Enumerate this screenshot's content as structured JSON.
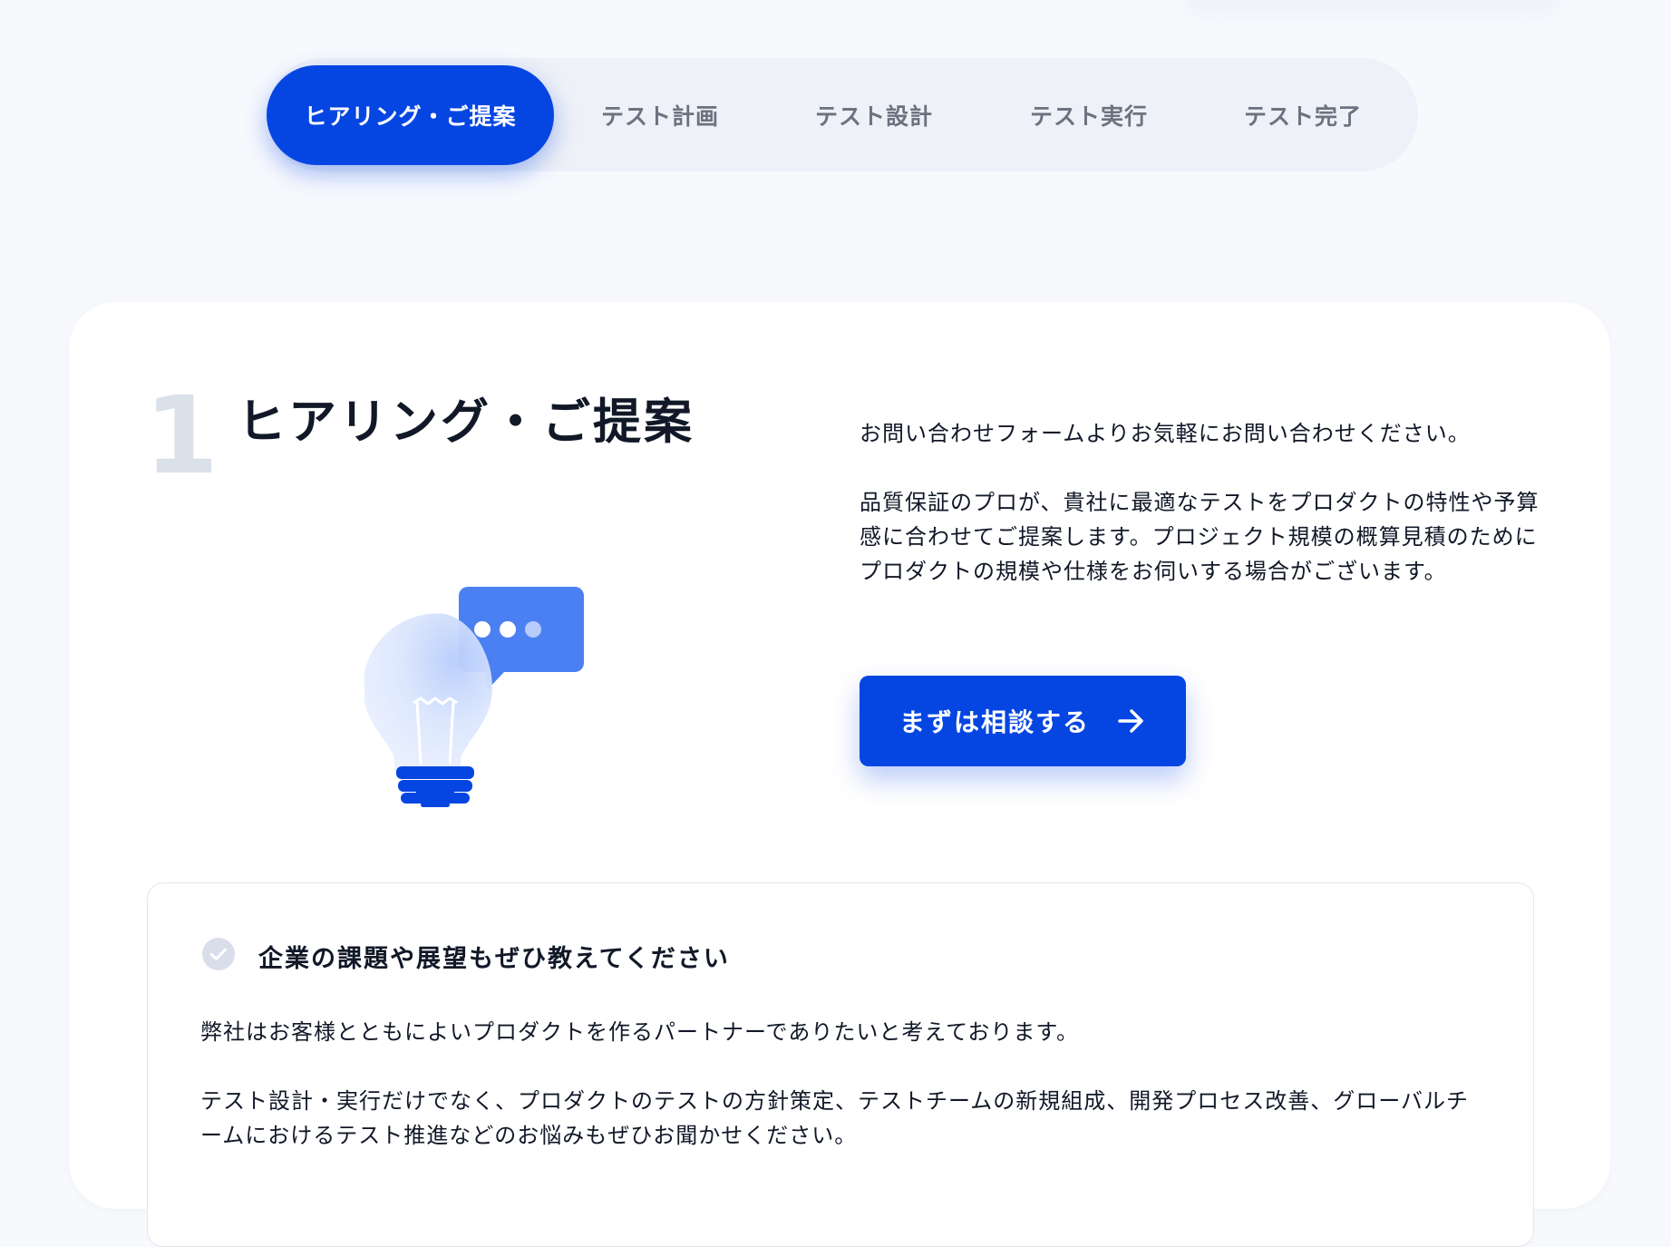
{
  "tabs": [
    {
      "label": "ヒアリング・ご提案",
      "active": true
    },
    {
      "label": "テスト計画",
      "active": false
    },
    {
      "label": "テスト設計",
      "active": false
    },
    {
      "label": "テスト実行",
      "active": false
    },
    {
      "label": "テスト完了",
      "active": false
    }
  ],
  "step": {
    "number": "1",
    "title": "ヒアリング・ご提案",
    "illustration_icon": "lightbulb-chat-icon",
    "description": [
      "お問い合わせフォームよりお気軽にお問い合わせください。",
      "品質保証のプロが、貴社に最適なテストをプロダクトの特性や予算感に合わせてご提案します。プロジェクト規模の概算見積のためにプロダクトの規模や仕様をお伺いする場合がございます。"
    ],
    "cta_label": "まずは相談する",
    "cta_icon": "arrow-right-icon"
  },
  "panel": {
    "icon": "check-circle-icon",
    "title": "企業の課題や展望もぜひ教えてください",
    "paragraphs": [
      "弊社はお客様とともによいプロダクトを作るパートナーでありたいと考えております。",
      "テスト設計・実行だけでなく、プロダクトのテストの方針策定、テストチームの新規組成、開発プロセス改善、グローバルチームにおけるテスト推進などのお悩みもぜひお聞かせください。"
    ]
  },
  "colors": {
    "accent": "#0546e2",
    "page_bg": "#f7f9fd",
    "tab_bg": "#eef1f7",
    "muted_number": "#dbe1ea"
  }
}
